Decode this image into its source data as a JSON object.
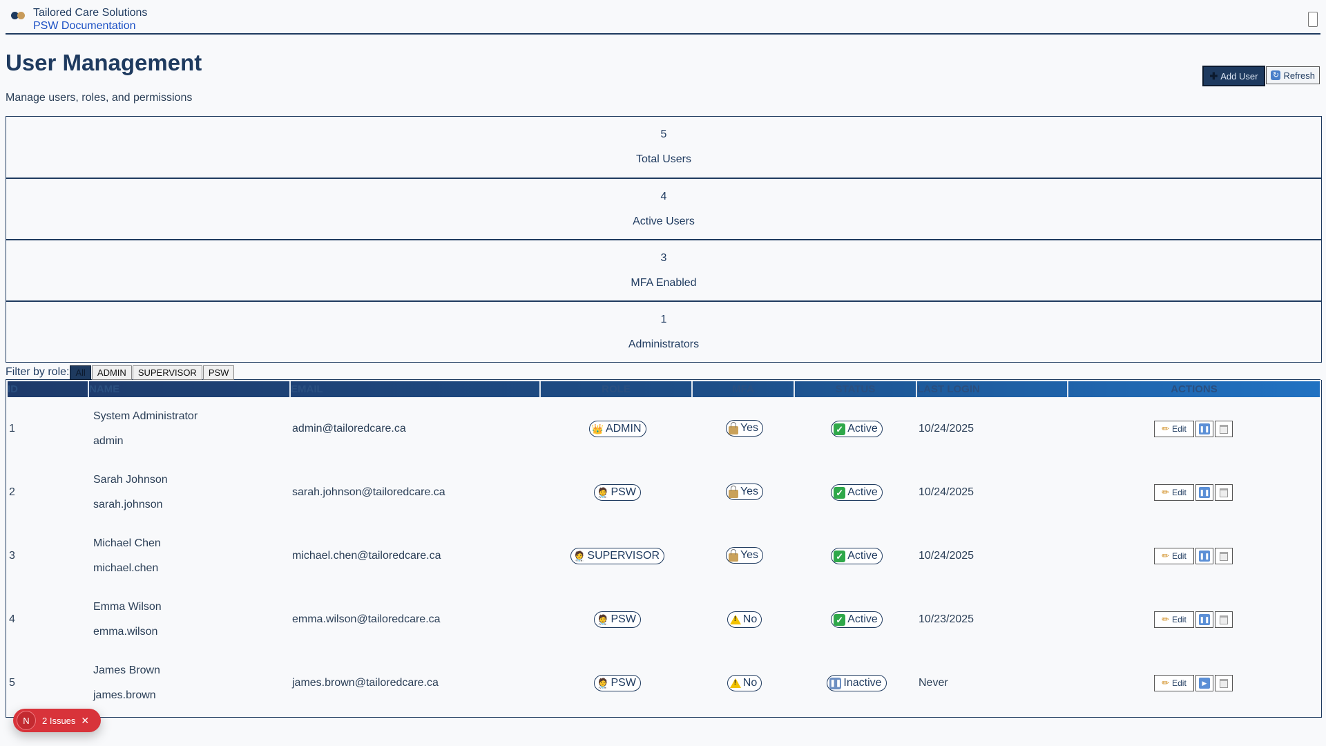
{
  "app": {
    "brand_name": "Tailored Care Solutions",
    "brand_sub": "PSW Documentation"
  },
  "page": {
    "title": "User Management",
    "subtitle": "Manage users, roles, and permissions",
    "add_user_label": "Add User",
    "refresh_label": "Refresh"
  },
  "stats": [
    {
      "value": "5",
      "label": "Total Users"
    },
    {
      "value": "4",
      "label": "Active Users"
    },
    {
      "value": "3",
      "label": "MFA Enabled"
    },
    {
      "value": "1",
      "label": "Administrators"
    }
  ],
  "filter": {
    "label": "Filter by role:",
    "options": [
      "All",
      "ADMIN",
      "SUPERVISOR",
      "PSW"
    ],
    "selected": "All"
  },
  "table": {
    "columns": [
      "ID",
      "NAME",
      "EMAIL",
      "ROLE",
      "MFA",
      "STATUS",
      "LAST LOGIN",
      "ACTIONS"
    ],
    "edit_label": "Edit",
    "rows": [
      {
        "id": "1",
        "name": "System Administrator",
        "username": "admin",
        "email": "admin@tailoredcare.ca",
        "role": "ADMIN",
        "role_icon": "crown",
        "mfa": "Yes",
        "status": "Active",
        "last_login": "10/24/2025"
      },
      {
        "id": "2",
        "name": "Sarah Johnson",
        "username": "sarah.johnson",
        "email": "sarah.johnson@tailoredcare.ca",
        "role": "PSW",
        "role_icon": "health-worker",
        "mfa": "Yes",
        "status": "Active",
        "last_login": "10/24/2025"
      },
      {
        "id": "3",
        "name": "Michael Chen",
        "username": "michael.chen",
        "email": "michael.chen@tailoredcare.ca",
        "role": "SUPERVISOR",
        "role_icon": "health-worker",
        "mfa": "Yes",
        "status": "Active",
        "last_login": "10/24/2025"
      },
      {
        "id": "4",
        "name": "Emma Wilson",
        "username": "emma.wilson",
        "email": "emma.wilson@tailoredcare.ca",
        "role": "PSW",
        "role_icon": "health-worker",
        "mfa": "No",
        "status": "Active",
        "last_login": "10/23/2025"
      },
      {
        "id": "5",
        "name": "James Brown",
        "username": "james.brown",
        "email": "james.brown@tailoredcare.ca",
        "role": "PSW",
        "role_icon": "health-worker",
        "mfa": "No",
        "status": "Inactive",
        "last_login": "Never"
      }
    ]
  },
  "issues_badge": {
    "avatar_letter": "N",
    "label": "2 Issues"
  }
}
